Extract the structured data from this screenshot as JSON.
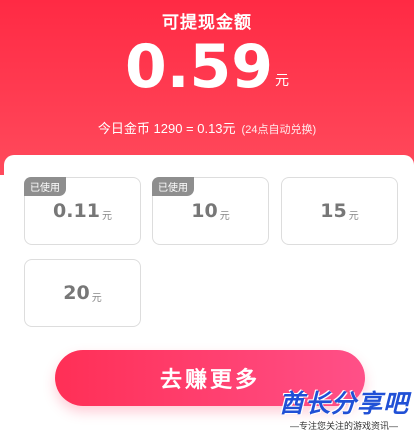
{
  "header": {
    "title": "可提现金额",
    "amount": "0.59",
    "amount_unit": "元",
    "rate_text": "今日金币 1290 = 0.13元",
    "rate_note": "(24点自动兑换)"
  },
  "options": [
    {
      "value": "0.11",
      "unit": "元",
      "badge": "已使用"
    },
    {
      "value": "10",
      "unit": "元",
      "badge": "已使用"
    },
    {
      "value": "15",
      "unit": "元",
      "badge": ""
    },
    {
      "value": "20",
      "unit": "元",
      "badge": ""
    }
  ],
  "cta": {
    "label": "去赚更多"
  },
  "watermark": {
    "main": "酋长分享吧",
    "sub": "—专注您关注的游戏资讯—"
  },
  "colors": {
    "brand_red": "#ff2a44",
    "cta_pink": "#ff4080",
    "badge_gray": "#8e8e8e",
    "watermark_blue": "#2050d6"
  }
}
